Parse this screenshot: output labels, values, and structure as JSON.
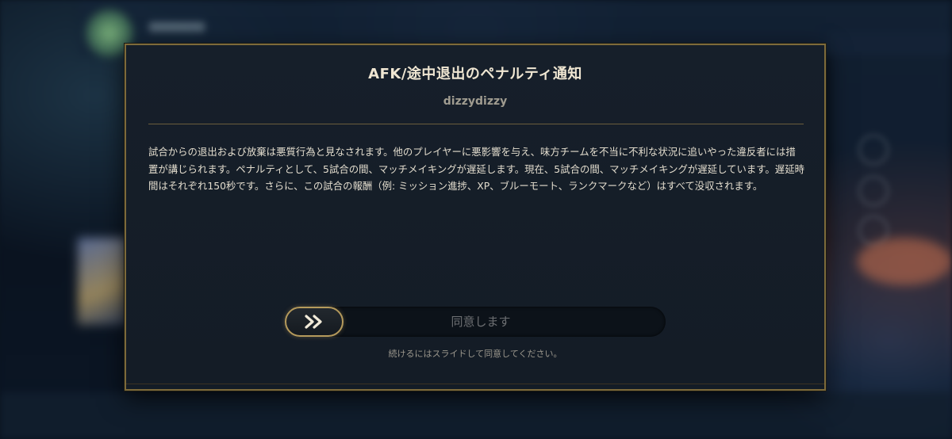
{
  "modal": {
    "title": "AFK/途中退出のペナルティ通知",
    "username": "dizzydizzy",
    "body": "試合からの退出および放棄は悪質行為と見なされます。他のプレイヤーに悪影響を与え、味方チームを不当に不利な状況に追いやった違反者には措置が講じられます。ペナルティとして、5試合の間、マッチメイキングが遅延します。現在、5試合の間、マッチメイキングが遅延しています。遅延時間はそれぞれ150秒です。さらに、この試合の報酬（例: ミッション進捗、XP、ブルーモート、ランクマークなど）はすべて没収されます。",
    "slider": {
      "label": "同意します",
      "knob_icon": "double-chevron-right-icon",
      "progress": 0
    },
    "hint": "続けるにはスライドして同意してください。"
  },
  "colors": {
    "border_gold": "#7d6a3a",
    "knob_gold": "#b59a5c",
    "title_text": "#efe6d2",
    "body_text": "#e2dccd",
    "panel_bg": "#161f2a"
  }
}
